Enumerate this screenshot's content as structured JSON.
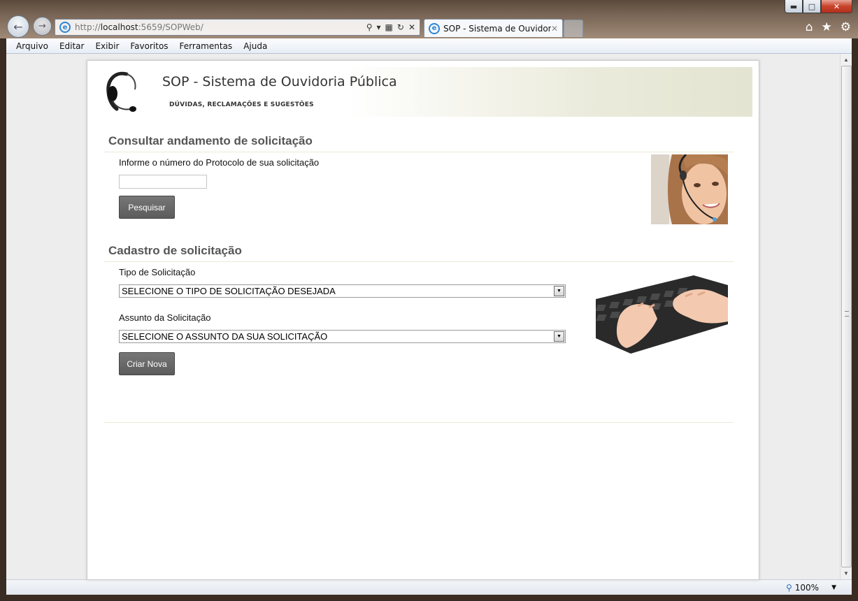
{
  "browser": {
    "url_prefix": "http://",
    "url_host": "localhost",
    "url_rest": ":5659/SOPWeb/",
    "tab_title": "SOP - Sistema de Ouvidoria...",
    "zoom": "100%",
    "menu": [
      "Arquivo",
      "Editar",
      "Exibir",
      "Favoritos",
      "Ferramentas",
      "Ajuda"
    ]
  },
  "header": {
    "title": "SOP - Sistema de Ouvidoria Pública",
    "subtitle": "DÚVIDAS, RECLAMAÇÕES E SUGESTÕES"
  },
  "consulta": {
    "title": "Consultar andamento de solicitação",
    "label": "Informe o número do Protocolo de sua solicitação",
    "input_value": "",
    "button": "Pesquisar"
  },
  "cadastro": {
    "title": "Cadastro de solicitação",
    "tipo_label": "Tipo de Solicitação",
    "tipo_selected": "SELECIONE O TIPO DE SOLICITAÇÃO DESEJADA",
    "assunto_label": "Assunto da Solicitação",
    "assunto_selected": "SELECIONE O ASSUNTO DA SUA SOLICITAÇÃO",
    "button": "Criar Nova"
  }
}
